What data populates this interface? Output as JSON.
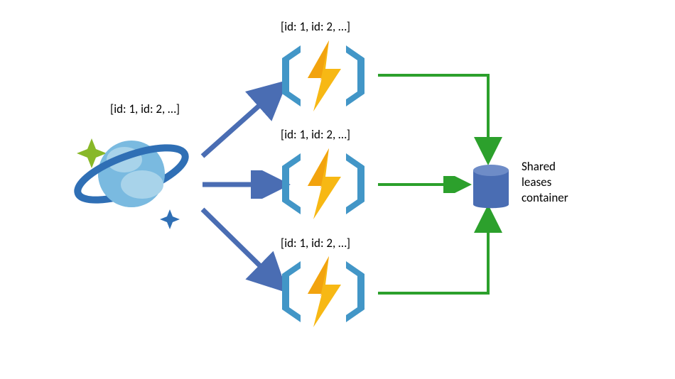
{
  "source": {
    "label": "[id: 1, id: 2, …]"
  },
  "functions": [
    {
      "label": "[id: 1, id: 2, …]"
    },
    {
      "label": "[id: 1, id: 2, …]"
    },
    {
      "label": "[id: 1, id: 2, …]"
    }
  ],
  "leases": {
    "line1": "Shared",
    "line2": "leases",
    "line3": "container"
  },
  "chart_data": {
    "type": "diagram",
    "nodes": [
      {
        "id": "cosmos",
        "label": "[id: 1, id: 2, …]",
        "type": "cosmos-db-source"
      },
      {
        "id": "fn1",
        "label": "[id: 1, id: 2, …]",
        "type": "azure-function"
      },
      {
        "id": "fn2",
        "label": "[id: 1, id: 2, …]",
        "type": "azure-function"
      },
      {
        "id": "fn3",
        "label": "[id: 1, id: 2, …]",
        "type": "azure-function"
      },
      {
        "id": "leases",
        "label": "Shared leases container",
        "type": "database"
      }
    ],
    "edges": [
      {
        "from": "cosmos",
        "to": "fn1",
        "color": "blue"
      },
      {
        "from": "cosmos",
        "to": "fn2",
        "color": "blue"
      },
      {
        "from": "cosmos",
        "to": "fn3",
        "color": "blue"
      },
      {
        "from": "fn1",
        "to": "leases",
        "color": "green"
      },
      {
        "from": "fn2",
        "to": "leases",
        "color": "green"
      },
      {
        "from": "fn3",
        "to": "leases",
        "color": "green"
      }
    ]
  }
}
